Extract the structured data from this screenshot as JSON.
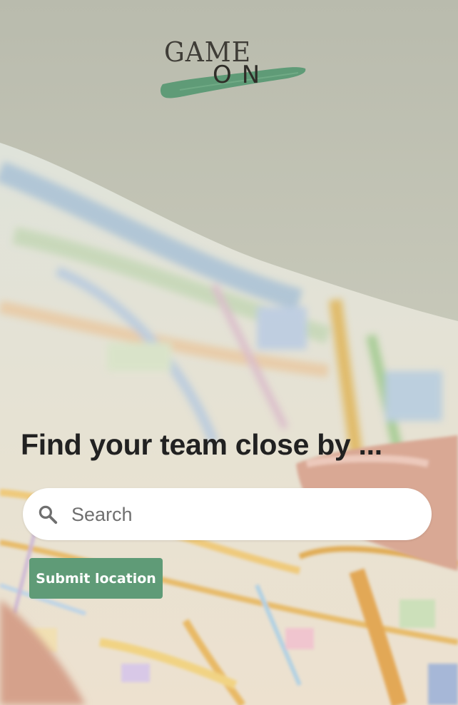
{
  "logo": {
    "line1": "GAME",
    "line2": "ON",
    "brush_color": "#5f9b77"
  },
  "hero": {
    "headline": "Find your team close by ..."
  },
  "search": {
    "placeholder": "Search",
    "value": "",
    "icon": "search-icon"
  },
  "submit": {
    "label": "Submit location",
    "color": "#5f9b77"
  },
  "background": {
    "subject": "city-map-photo"
  }
}
